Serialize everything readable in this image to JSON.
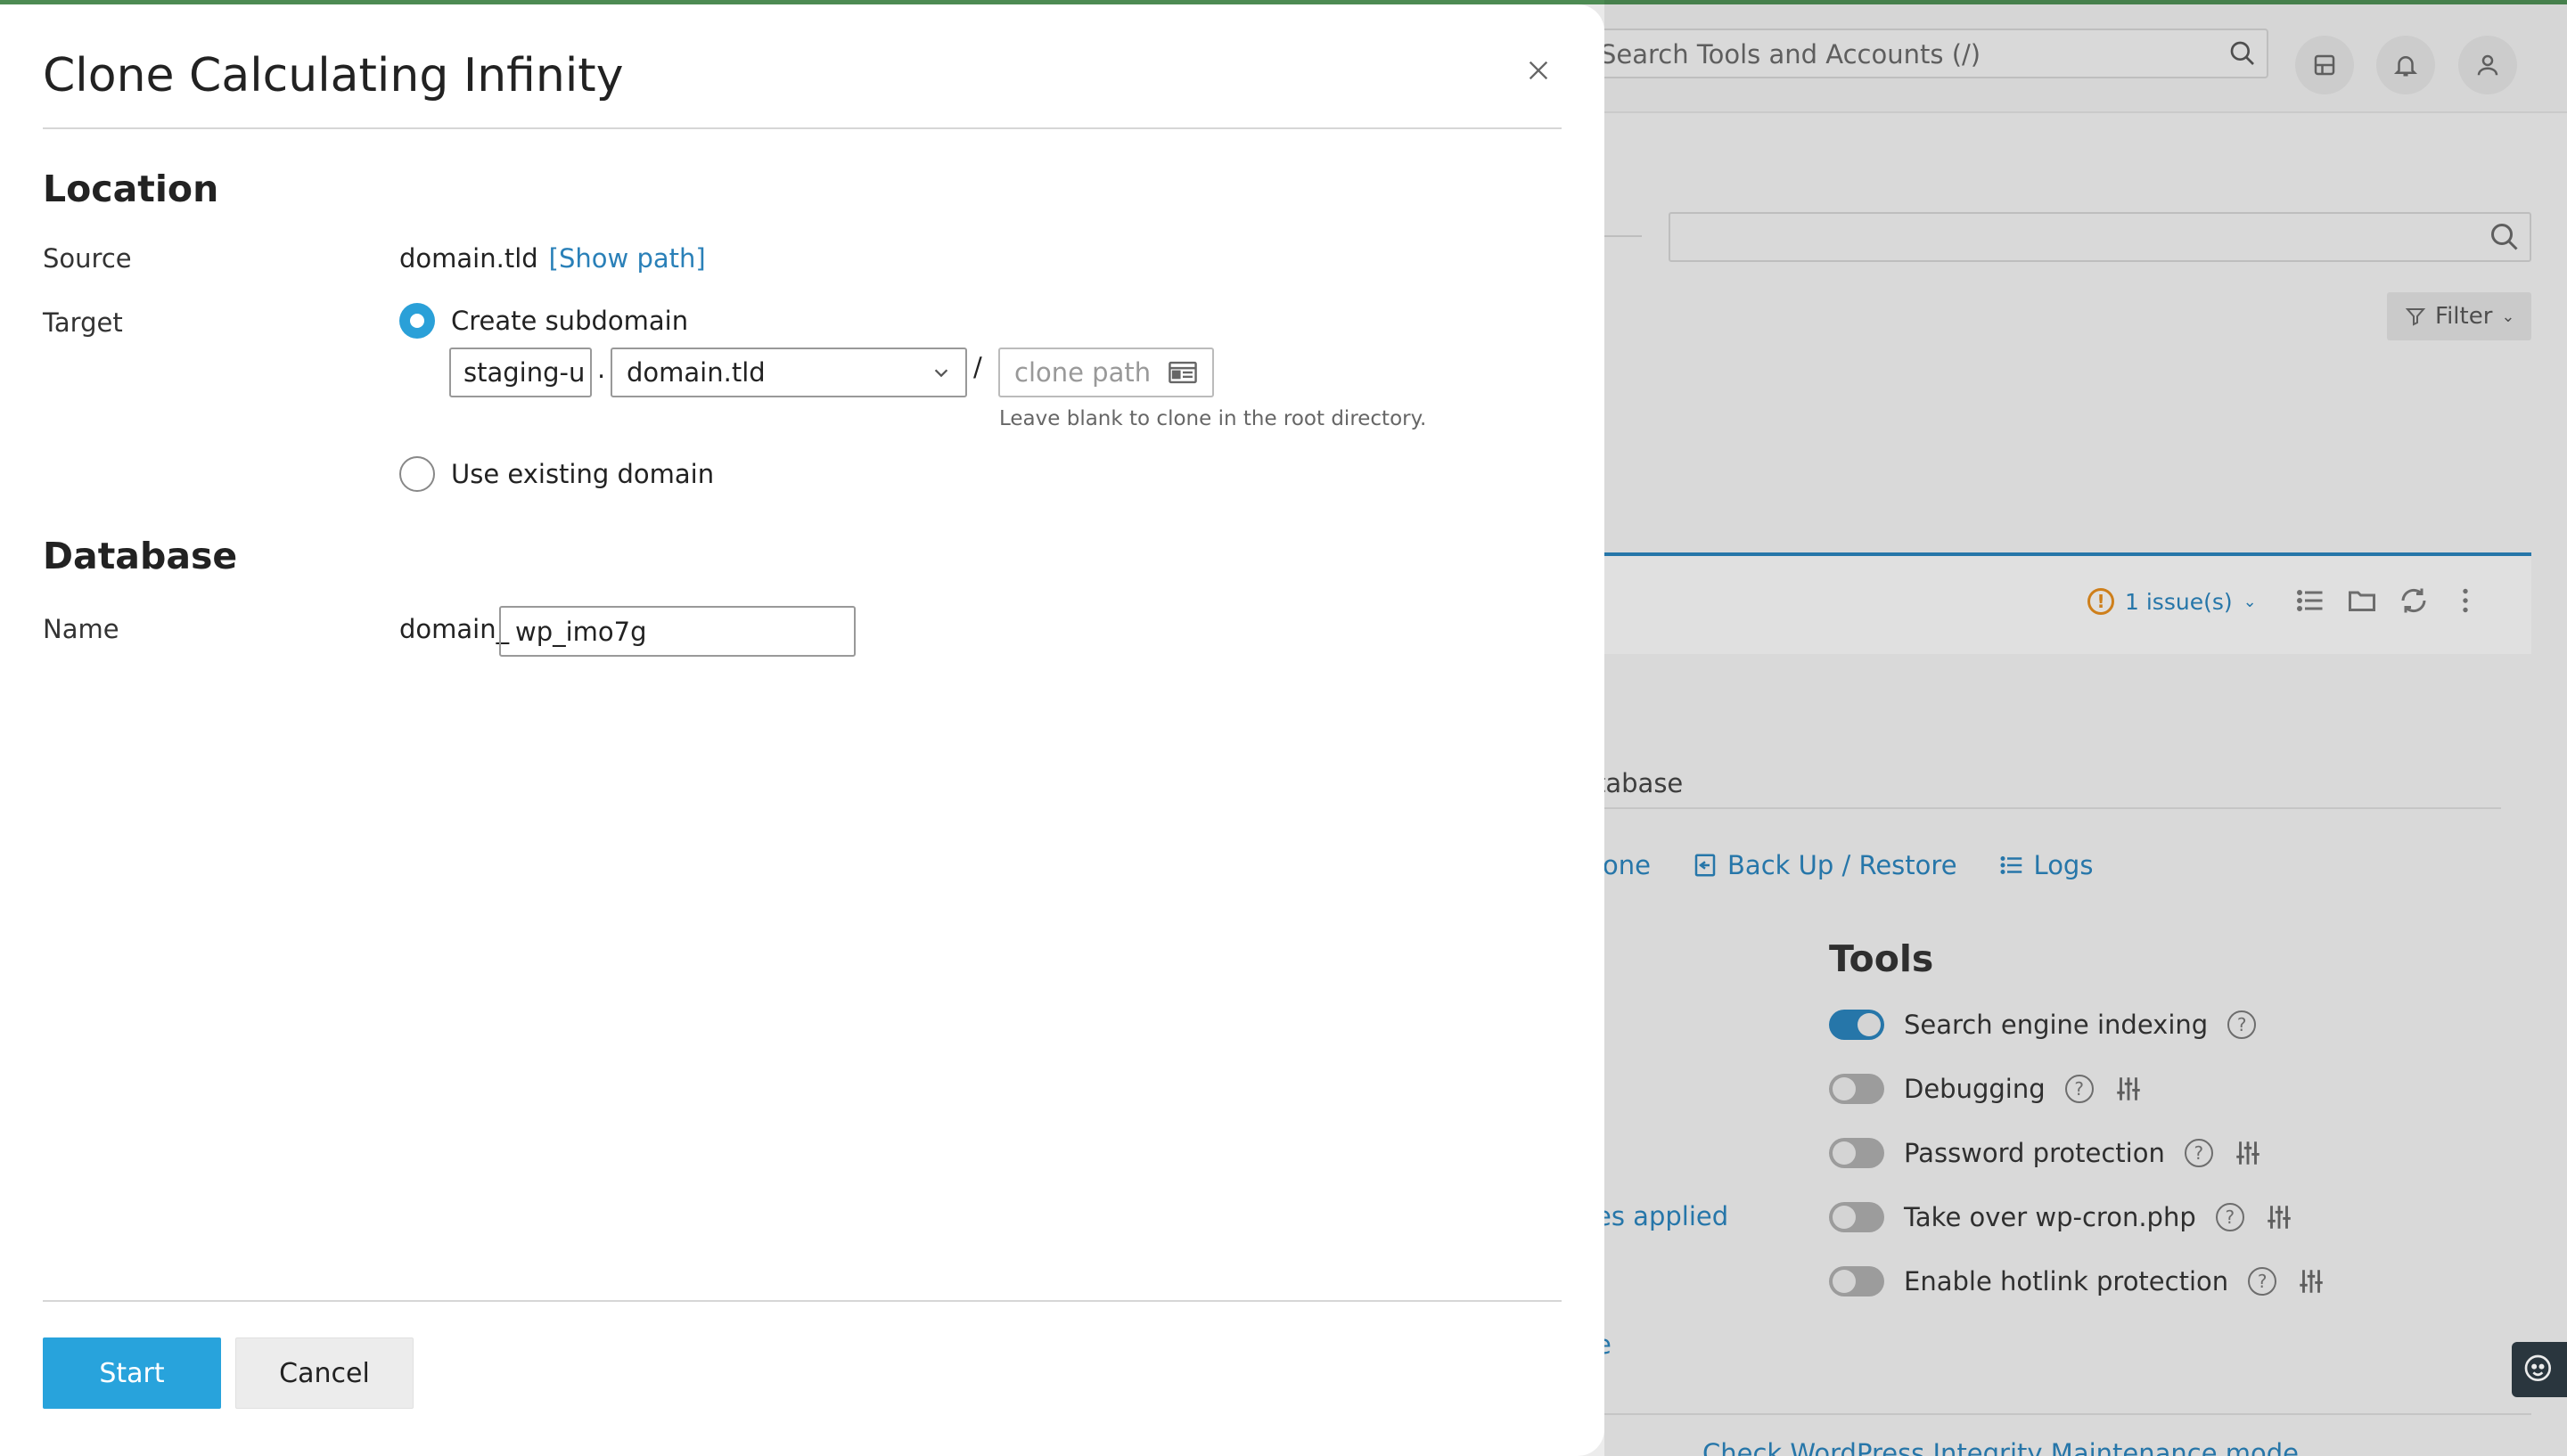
{
  "background": {
    "search_placeholder": "Search Tools and Accounts (/)",
    "filter_label": "Filter",
    "issues_label": "1 issue(s)",
    "database_tab_fragment": "tabase",
    "links": {
      "clone": "lone",
      "backup": "Back Up / Restore",
      "logs": "Logs"
    },
    "tools_title": "Tools",
    "toggles": [
      {
        "label": "Search engine indexing",
        "on": true
      },
      {
        "label": "Debugging",
        "on": false
      },
      {
        "label": "Password protection",
        "on": false
      },
      {
        "label": "Take over wp-cron.php",
        "on": false
      },
      {
        "label": "Enable hotlink protection",
        "on": false
      }
    ],
    "fixes_fragment": "es applied",
    "e_fragment": "e",
    "bottom_fragment": "Check WordPress Integrity        Maintenance mode"
  },
  "modal": {
    "title": "Clone Calculating Infinity",
    "location_heading": "Location",
    "source_label": "Source",
    "source_value": "domain.tld",
    "show_path_link": "[Show path]",
    "target_label": "Target",
    "create_subdomain_label": "Create subdomain",
    "subdomain_value": "staging-u",
    "dot": ".",
    "domain_select_value": "domain.tld",
    "slash": "/",
    "clone_path_placeholder": "clone path",
    "clone_path_hint": "Leave blank to clone in the root directory.",
    "use_existing_label": "Use existing domain",
    "database_heading": "Database",
    "name_label": "Name",
    "db_prefix": "domain_",
    "db_name_value": "wp_imo7g",
    "start_button": "Start",
    "cancel_button": "Cancel"
  },
  "colors": {
    "accent": "#28a3dc",
    "link": "#2a80b8",
    "warning": "#e08a1e"
  }
}
